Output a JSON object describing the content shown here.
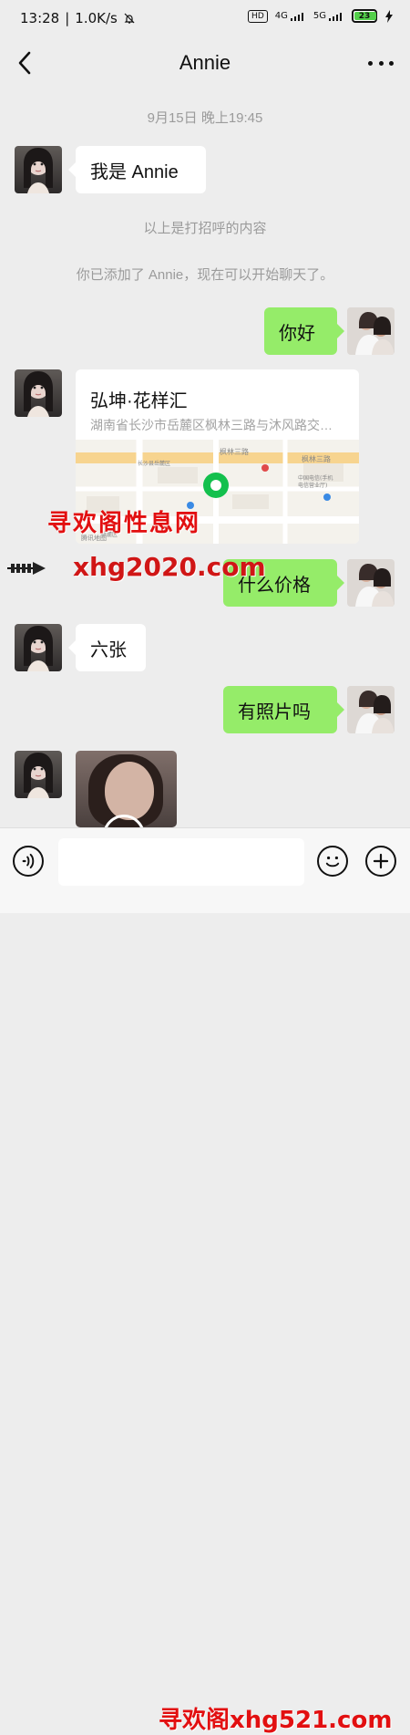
{
  "status_bar": {
    "time": "13:28",
    "network_speed": "1.0K/s",
    "hd_label": "HD",
    "signal_4g": "4G",
    "signal_5g": "5G",
    "battery_level": "23"
  },
  "header": {
    "title": "Annie"
  },
  "chat": {
    "timestamp": "9月15日 晚上19:45",
    "incoming_intro": "我是 Annie",
    "system_1": "以上是打招呼的内容",
    "system_2": "你已添加了 Annie，现在可以开始聊天了。",
    "outgoing_hello": "你好",
    "location": {
      "title": "弘坤·花样汇",
      "address": "湖南省长沙市岳麓区枫林三路与沐风路交汇处",
      "map_labels": [
        "枫林三路",
        "枫林三路",
        "长沙县岳麓区",
        "中国电信(手机",
        "电信营业厅)",
        "岳麓区",
        "腾讯地图"
      ]
    },
    "outgoing_price": "什么价格",
    "incoming_price": "六张",
    "outgoing_photo_request": "有照片吗"
  },
  "watermarks": {
    "line_1": "寻欢阁性息网",
    "line_2": "xhg2020.com",
    "line_3": "寻欢阁xhg521.com"
  },
  "input": {
    "placeholder": ""
  },
  "icons": {
    "back": "back-icon",
    "more": "more-icon",
    "voice": "voice-icon",
    "emoji": "emoji-icon",
    "plus": "plus-icon",
    "location_pin": "location-pin-icon"
  }
}
